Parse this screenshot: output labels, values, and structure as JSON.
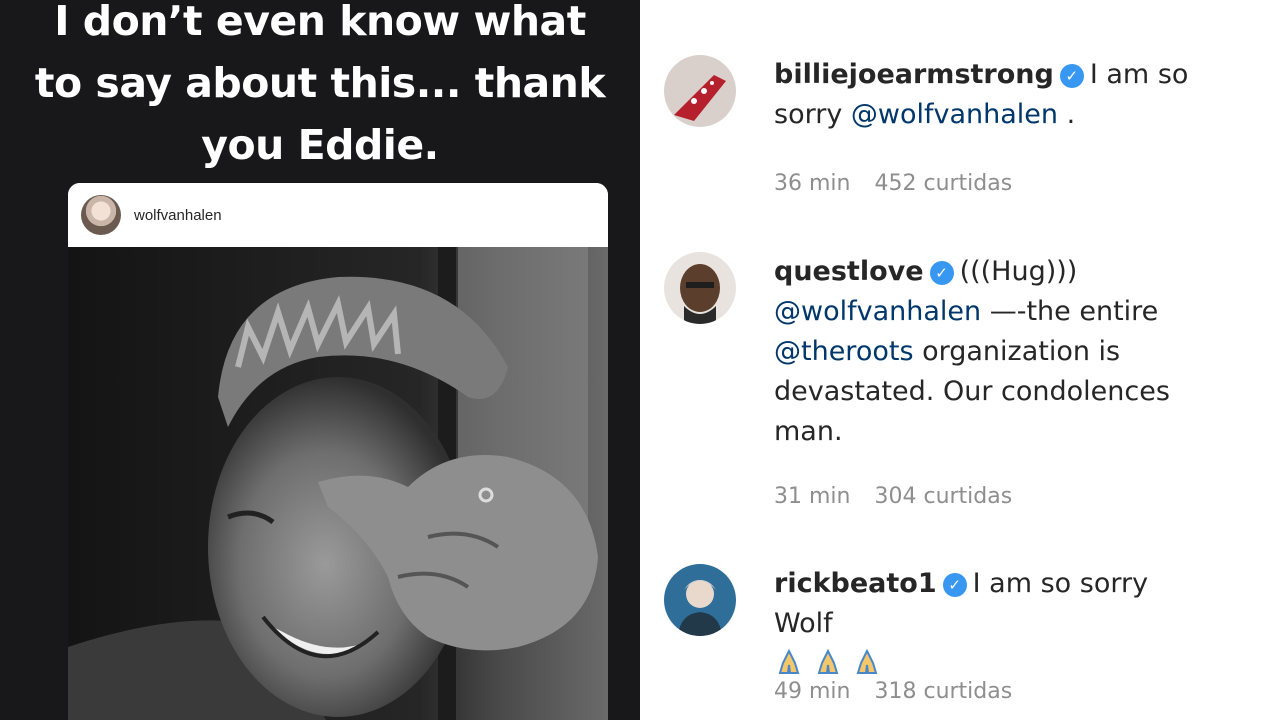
{
  "story": {
    "caption_lines": [
      "I don’t even know what",
      "to say about this... thank",
      "you Eddie."
    ],
    "post_username": "wolfvanhalen"
  },
  "comments": [
    {
      "username": "billiejoearmstrong",
      "text_parts": [
        "I am so sorry ",
        "@wolfvanhalen",
        " ."
      ],
      "time": "36 min",
      "likes": "452 curtidas"
    },
    {
      "username": "questlove",
      "text_parts": [
        "(((Hug)))",
        "@wolfvanhalen",
        " —-the entire ",
        "@theroots",
        " organization is devastated. Our condolences man."
      ],
      "time": "31 min",
      "likes": "304 curtidas"
    },
    {
      "username": "rickbeato1",
      "text_parts": [
        "I am so sorry Wolf"
      ],
      "emoji": [
        "folded-hands-icon",
        "folded-hands-icon",
        "folded-hands-icon"
      ],
      "time": "49 min",
      "likes": "318 curtidas"
    }
  ],
  "colors": {
    "verified": "#3897f0",
    "mention": "#00376b",
    "meta": "#8e8e8e",
    "story_bg": "#18181a"
  }
}
